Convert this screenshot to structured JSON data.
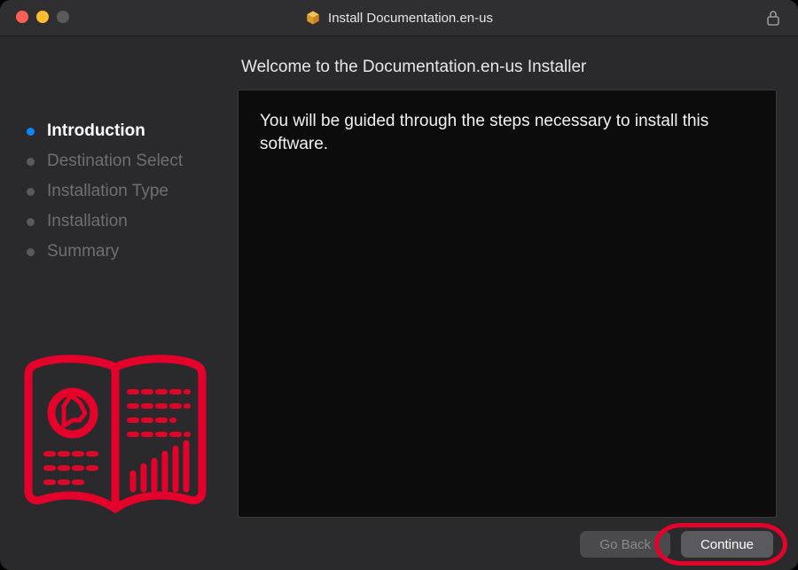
{
  "window": {
    "title": "Install Documentation.en-us"
  },
  "sidebar": {
    "steps": [
      {
        "label": "Introduction",
        "active": true
      },
      {
        "label": "Destination Select",
        "active": false
      },
      {
        "label": "Installation Type",
        "active": false
      },
      {
        "label": "Installation",
        "active": false
      },
      {
        "label": "Summary",
        "active": false
      }
    ]
  },
  "main": {
    "heading": "Welcome to the Documentation.en-us Installer",
    "body_text": "You will be guided through the steps necessary to install this software."
  },
  "footer": {
    "go_back_label": "Go Back",
    "continue_label": "Continue"
  },
  "colors": {
    "accent": "#0a84ff",
    "highlight": "#e4002b"
  }
}
